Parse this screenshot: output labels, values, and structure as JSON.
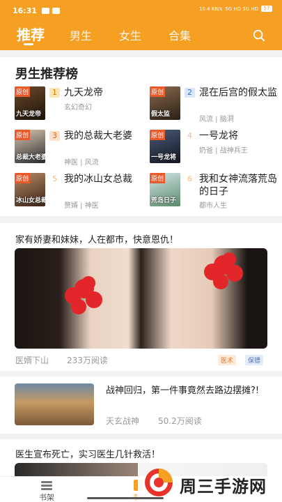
{
  "status": {
    "time": "16:31",
    "net": "10.4 KB/s",
    "signal": "5G HD 5G HD",
    "battery": "57"
  },
  "tabs": [
    {
      "label": "推荐"
    },
    {
      "label": "男生"
    },
    {
      "label": "女生"
    },
    {
      "label": "合集"
    }
  ],
  "rank": {
    "title": "男生推荐榜",
    "books": [
      {
        "rank": "1",
        "title": "九天龙帝",
        "meta": "玄幻奇幻",
        "badge": "原创",
        "cover_text": "九天龙帝"
      },
      {
        "rank": "2",
        "title": "混在后宫的假太监",
        "meta": "风流 | 脑洞",
        "badge": "原创",
        "cover_text": "假太监"
      },
      {
        "rank": "3",
        "title": "我的总裁大老婆",
        "meta": "神医 | 风流",
        "badge": "原创",
        "cover_text": "总裁大老婆"
      },
      {
        "rank": "4",
        "title": "一号龙将",
        "meta": "奶爸 | 战神兵王",
        "badge": "原创",
        "cover_text": "一号龙将"
      },
      {
        "rank": "5",
        "title": "我的冰山女总裁",
        "meta": "赘婿 | 神医",
        "badge": "原创",
        "cover_text": "冰山女总裁"
      },
      {
        "rank": "6",
        "title": "我和女神流落荒岛的日子",
        "meta": "都市人生",
        "badge": "原创",
        "cover_text": "荒岛日子"
      }
    ]
  },
  "feed": [
    {
      "headline": "家有娇妻和妹妹，人在都市，快意恩仇！",
      "author": "医婿下山",
      "reads": "233万阅读",
      "tags": [
        "医术",
        "保镖"
      ]
    },
    {
      "headline": "战神回归，第一件事竟然去路边摆摊?!",
      "author": "天玄战神",
      "reads": "50.2万阅读"
    },
    {
      "headline": "医生宣布死亡，实习医生几针救活！"
    }
  ],
  "bottom_nav": {
    "shelf": "书架",
    "store": "书城"
  },
  "watermark": {
    "text": "周三手游网"
  },
  "colors": {
    "brand": "#f6a023",
    "badge": "#e85a2a"
  }
}
